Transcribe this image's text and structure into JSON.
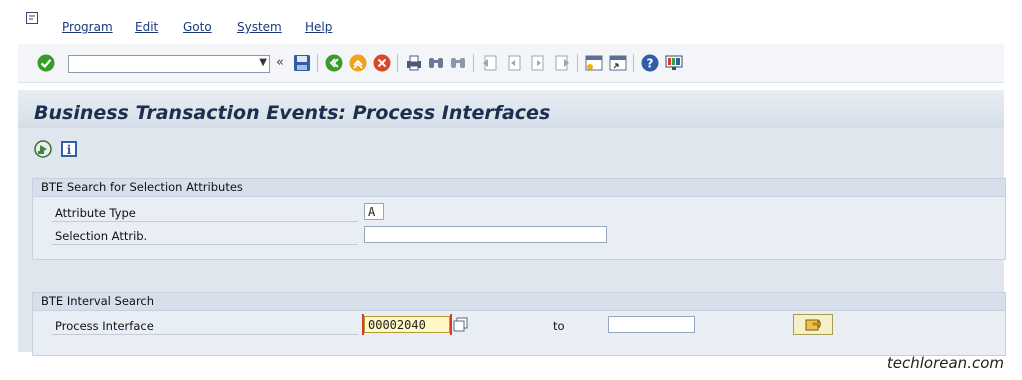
{
  "menu": {
    "items": [
      "Program",
      "Edit",
      "Goto",
      "System",
      "Help"
    ]
  },
  "toolbar": {
    "command_field_value": "",
    "icons": [
      "enter-icon",
      "dropdown-icon",
      "double-chevron-icon",
      "save-icon",
      "back-icon",
      "exit-icon",
      "cancel-icon",
      "print-icon",
      "find-icon",
      "find-next-icon",
      "first-page-icon",
      "previous-page-icon",
      "next-page-icon",
      "last-page-icon",
      "create-session-icon",
      "shortcut-icon",
      "help-icon",
      "customize-layout-icon"
    ]
  },
  "page": {
    "title": "Business Transaction Events: Process Interfaces",
    "app_icons": [
      "execute-icon",
      "info-icon"
    ]
  },
  "group_selection": {
    "header": "BTE Search for Selection Attributes",
    "attribute_type_label": "Attribute Type",
    "attribute_type_value": "A",
    "selection_attrib_label": "Selection Attrib.",
    "selection_attrib_value": ""
  },
  "group_interval": {
    "header": "BTE Interval Search",
    "process_interface_label": "Process Interface",
    "process_interface_from": "00002040",
    "to_label": "to",
    "process_interface_to": ""
  },
  "watermark": "techlorean.com",
  "colors": {
    "title_text": "#1c2f4f",
    "group_header_bg": "#d7e0ea",
    "highlight_field_bg": "#fff7c4",
    "link_text": "#1a3a7a"
  }
}
